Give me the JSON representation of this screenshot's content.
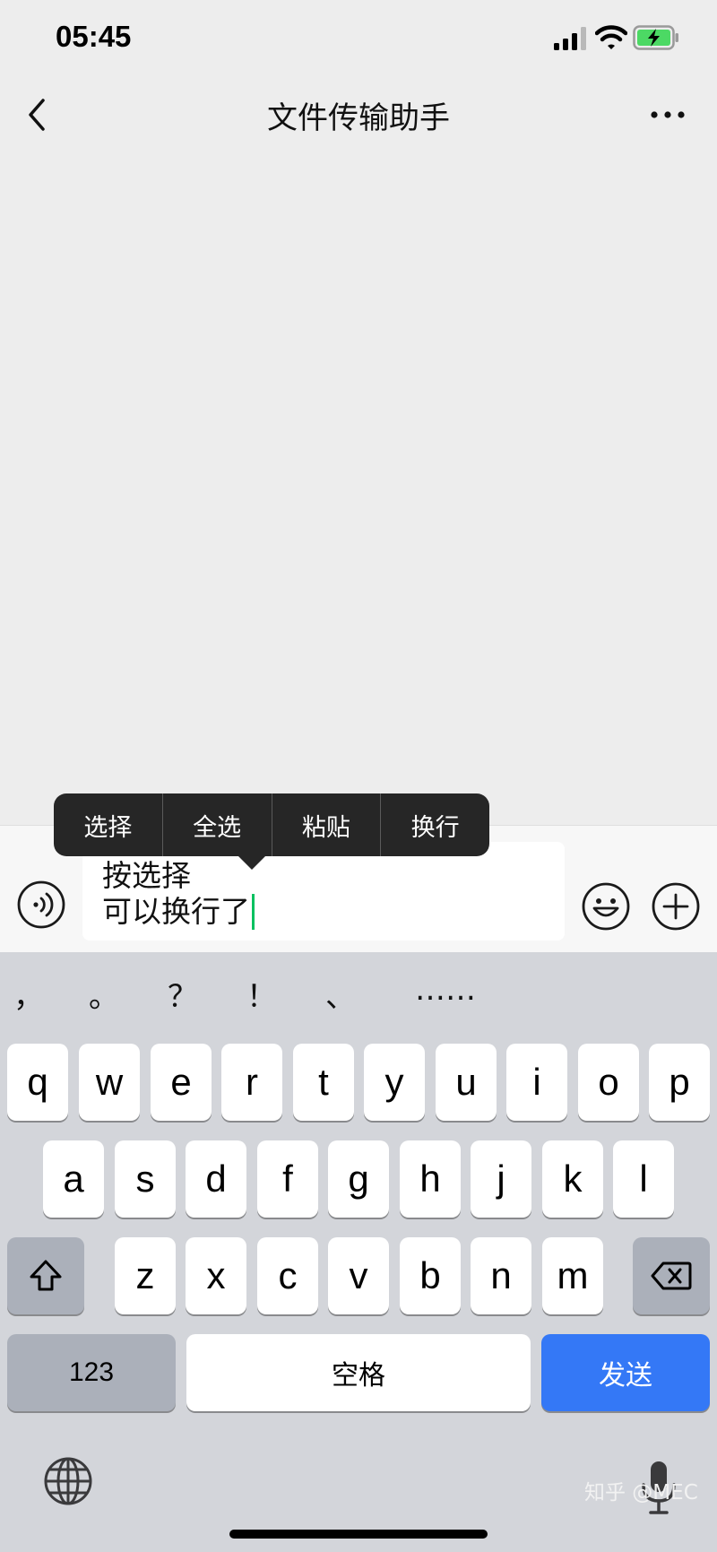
{
  "status_bar": {
    "time": "05:45"
  },
  "nav": {
    "title": "文件传输助手"
  },
  "context_menu": {
    "items": [
      "选择",
      "全选",
      "粘贴",
      "换行"
    ]
  },
  "input": {
    "lines": [
      "按选择",
      "可以换行了"
    ]
  },
  "keyboard": {
    "punctuation": [
      "，",
      "。",
      "？",
      "！",
      "、",
      "……"
    ],
    "row1": [
      "q",
      "w",
      "e",
      "r",
      "t",
      "y",
      "u",
      "i",
      "o",
      "p"
    ],
    "row2": [
      "a",
      "s",
      "d",
      "f",
      "g",
      "h",
      "j",
      "k",
      "l"
    ],
    "row3": [
      "z",
      "x",
      "c",
      "v",
      "b",
      "n",
      "m"
    ],
    "numbers_label": "123",
    "space_label": "空格",
    "send_label": "发送"
  },
  "watermark": "知乎 @MEC",
  "colors": {
    "send": "#3478f6",
    "caret": "#07c160",
    "menu": "#262626"
  }
}
